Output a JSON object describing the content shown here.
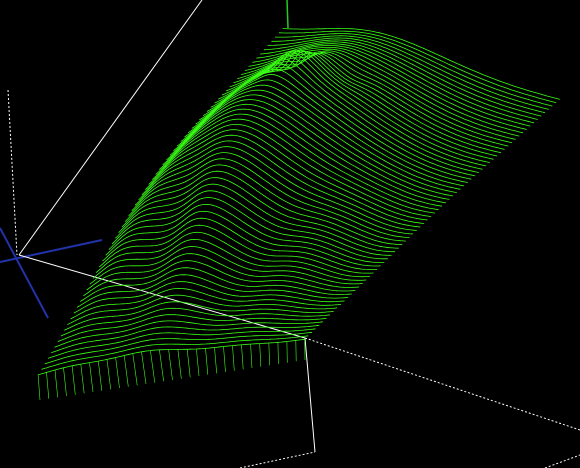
{
  "viewport": {
    "background": "#000000",
    "mesh_color": "#39ff14",
    "box_color": "#ffffff",
    "axis_colors": {
      "x": "#2233aa",
      "y": "#2233aa",
      "z": "#22cc22"
    }
  },
  "model": {
    "subject": "relief-face-toolpath",
    "render_mode": "contour-wireframe"
  }
}
